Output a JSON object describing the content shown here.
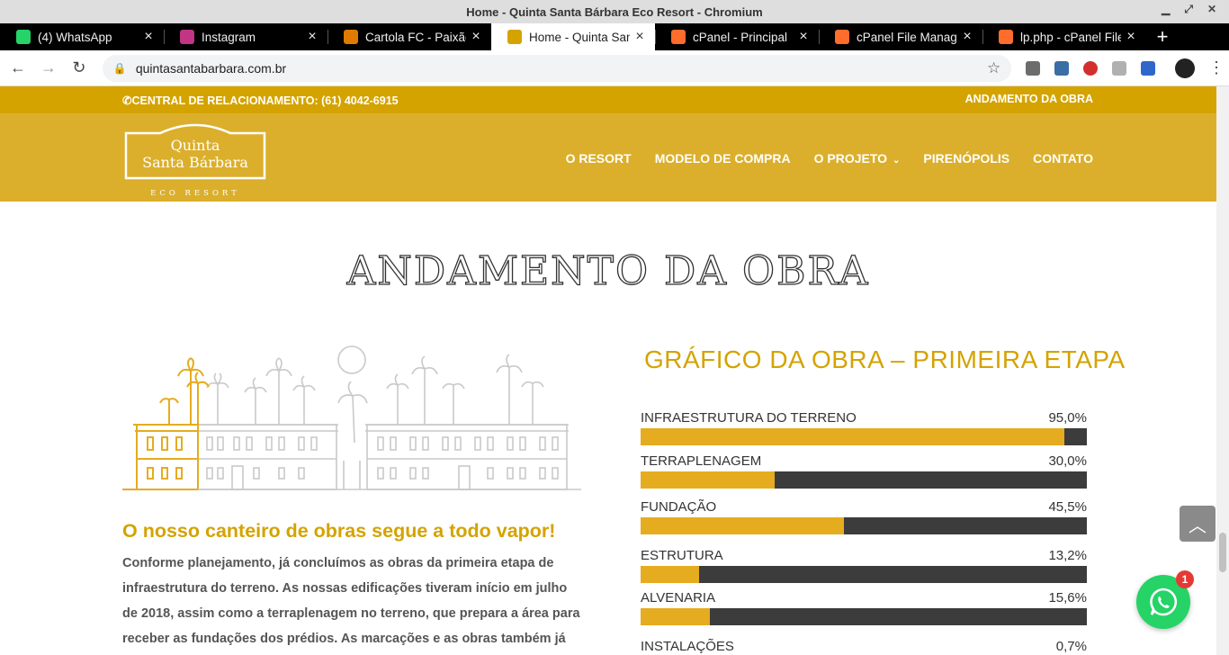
{
  "window": {
    "title": "Home - Quinta Santa Bárbara Eco Resort - Chromium"
  },
  "tabs": [
    {
      "label": "(4) WhatsApp",
      "icon": "whatsapp-icon",
      "color": "#25d366",
      "active": false
    },
    {
      "label": "Instagram",
      "icon": "instagram-icon",
      "color": "#c13584",
      "active": false
    },
    {
      "label": "Cartola FC - Paixão,",
      "icon": "cartola-icon",
      "color": "#e07b00",
      "active": false
    },
    {
      "label": "Home - Quinta Santa",
      "icon": "resort-icon",
      "color": "#d4a300",
      "active": true
    },
    {
      "label": "cPanel - Principal",
      "icon": "cpanel-icon",
      "color": "#ff6c2c",
      "active": false
    },
    {
      "label": "cPanel File Manager",
      "icon": "cpanel-icon",
      "color": "#ff6c2c",
      "active": false
    },
    {
      "label": "lp.php - cPanel File",
      "icon": "cpanel-icon",
      "color": "#ff6c2c",
      "active": false
    }
  ],
  "toolbar": {
    "url": "quintasantabarbara.com.br"
  },
  "topbar": {
    "phone": "CENTRAL DE RELACIONAMENTO: (61) 4042-6915",
    "obra_link": "ANDAMENTO DA OBRA"
  },
  "header": {
    "logo_line1": "Quinta",
    "logo_line2": "Santa Bárbara",
    "logo_sub": "ECO RESORT",
    "nav": [
      "O RESORT",
      "MODELO DE COMPRA",
      "O PROJETO",
      "PIRENÓPOLIS",
      "CONTATO"
    ]
  },
  "main": {
    "title": "ANDAMENTO DA OBRA",
    "lead": "O nosso canteiro de obras segue a todo vapor!",
    "body": "Conforme planejamento, já concluímos as obras da primeira etapa de infraestrutura do terreno. As nossas edificações tiveram início em julho de 2018, assim como a terraplenagem no terreno, que prepara a área para receber as fundações dos prédios. As marcações e as obras também já"
  },
  "chart_title": "GRÁFICO DA OBRA – PRIMEIRA ETAPA",
  "chart_data": {
    "type": "bar",
    "title": "GRÁFICO DA OBRA – PRIMEIRA ETAPA",
    "categories": [
      "INFRAESTRUTURA DO TERRENO",
      "TERRAPLENAGEM",
      "FUNDAÇÃO",
      "ESTRUTURA",
      "ALVENARIA",
      "INSTALAÇÕES"
    ],
    "values": [
      95.0,
      30.0,
      45.5,
      13.2,
      15.6,
      0.7
    ],
    "value_labels": [
      "95,0%",
      "30,0%",
      "45,5%",
      "13,2%",
      "15,6%",
      "0,7%"
    ],
    "ylim": [
      0,
      100
    ],
    "colors": {
      "fill": "#e6ac1f",
      "track": "#3c3c3c"
    }
  },
  "widgets": {
    "whatsapp_badge": "1"
  }
}
